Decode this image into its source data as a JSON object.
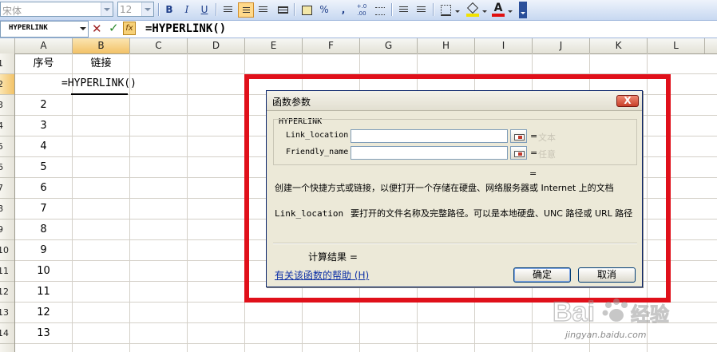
{
  "toolbar": {
    "font_name": "宋体",
    "font_size": "12",
    "bold": "B",
    "italic": "I",
    "underline": "U",
    "percent": "%",
    "comma": ",",
    "increase_decimal": "+.0 .00",
    "font_color_letter": "A",
    "highlight_color": "#f2e200",
    "font_color": "#e01010"
  },
  "formula_bar": {
    "name_box": "HYPERLINK",
    "fx": "fx",
    "formula": "=HYPERLINK()"
  },
  "columns": [
    "A",
    "B",
    "C",
    "D",
    "E",
    "F",
    "G",
    "H",
    "I",
    "J",
    "K",
    "L"
  ],
  "rows": [
    "1",
    "2",
    "3",
    "4",
    "5",
    "6",
    "7",
    "8",
    "9",
    "10",
    "11",
    "12",
    "13",
    "14"
  ],
  "cells": {
    "a1": "序号",
    "b1": "链接",
    "b2": "=HYPERLINK()",
    "a_values": [
      "2",
      "3",
      "4",
      "5",
      "6",
      "7",
      "8",
      "9",
      "10",
      "11",
      "12",
      "13"
    ]
  },
  "dialog": {
    "title": "函数参数",
    "close": "X",
    "function_name": "HYPERLINK",
    "arg1_label": "Link_location",
    "arg1_value": "",
    "arg1_eq": "=",
    "arg1_hint": "文本",
    "arg2_label": "Friendly_name",
    "arg2_value": "",
    "arg2_eq": "=",
    "arg2_hint": "任意",
    "result_eq": "=",
    "description": "创建一个快捷方式或链接，以便打开一个存储在硬盘、网络服务器或  Internet 上的文档",
    "param_name": "Link_location",
    "param_desc": "要打开的文件名称及完整路径。可以是本地硬盘、UNC 路径或 URL 路径",
    "calc_result_label": "计算结果 =",
    "help_link": "有关该函数的帮助 (H)",
    "ok_button": "确定",
    "cancel_button": "取消"
  },
  "highlight_frame_color": "#e0101a",
  "watermark": {
    "brand": "Bai 经验",
    "url": "jingyan.baidu.com"
  }
}
